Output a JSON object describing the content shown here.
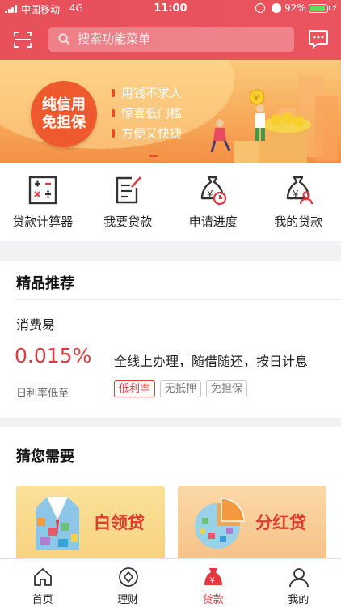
{
  "status_bar": {
    "carrier": "中国移动",
    "network": "4G",
    "time": "11:00",
    "battery": "92%"
  },
  "header": {
    "search_placeholder": "搜索功能菜单",
    "icons": [
      "scan-icon",
      "message-icon"
    ]
  },
  "banner": {
    "badge_line1": "纯信用",
    "badge_line2": "免担保",
    "bullets": [
      "用钱不求人",
      "惊喜低门槛",
      "方便又快捷"
    ]
  },
  "quick_actions": [
    {
      "label": "贷款计算器",
      "icon": "calculator-icon"
    },
    {
      "label": "我要贷款",
      "icon": "document-edit-icon"
    },
    {
      "label": "申请进度",
      "icon": "money-bag-clock-icon"
    },
    {
      "label": "我的贷款",
      "icon": "money-bag-user-icon"
    }
  ],
  "recommended": {
    "title": "精品推荐",
    "product_name": "消费易",
    "rate": "0.015%",
    "rate_label": "日利率低至",
    "description": "全线上办理，随借随还，按日计息",
    "tags": [
      "低利率",
      "无抵押",
      "免担保"
    ]
  },
  "guess": {
    "title": "猜您需要",
    "cards": [
      {
        "title": "白领贷",
        "icon": "suit-collage-icon"
      },
      {
        "title": "分红贷",
        "icon": "pie-chart-collage-icon"
      }
    ]
  },
  "tab_bar": [
    {
      "label": "首页",
      "icon": "home-icon"
    },
    {
      "label": "理财",
      "icon": "finance-icon"
    },
    {
      "label": "贷款",
      "icon": "loan-bag-icon",
      "active": true
    },
    {
      "label": "我的",
      "icon": "profile-icon"
    }
  ],
  "colors": {
    "brand_red": "#e8505a",
    "accent_red": "#e2393f",
    "banner_orange": "#f6a858"
  }
}
